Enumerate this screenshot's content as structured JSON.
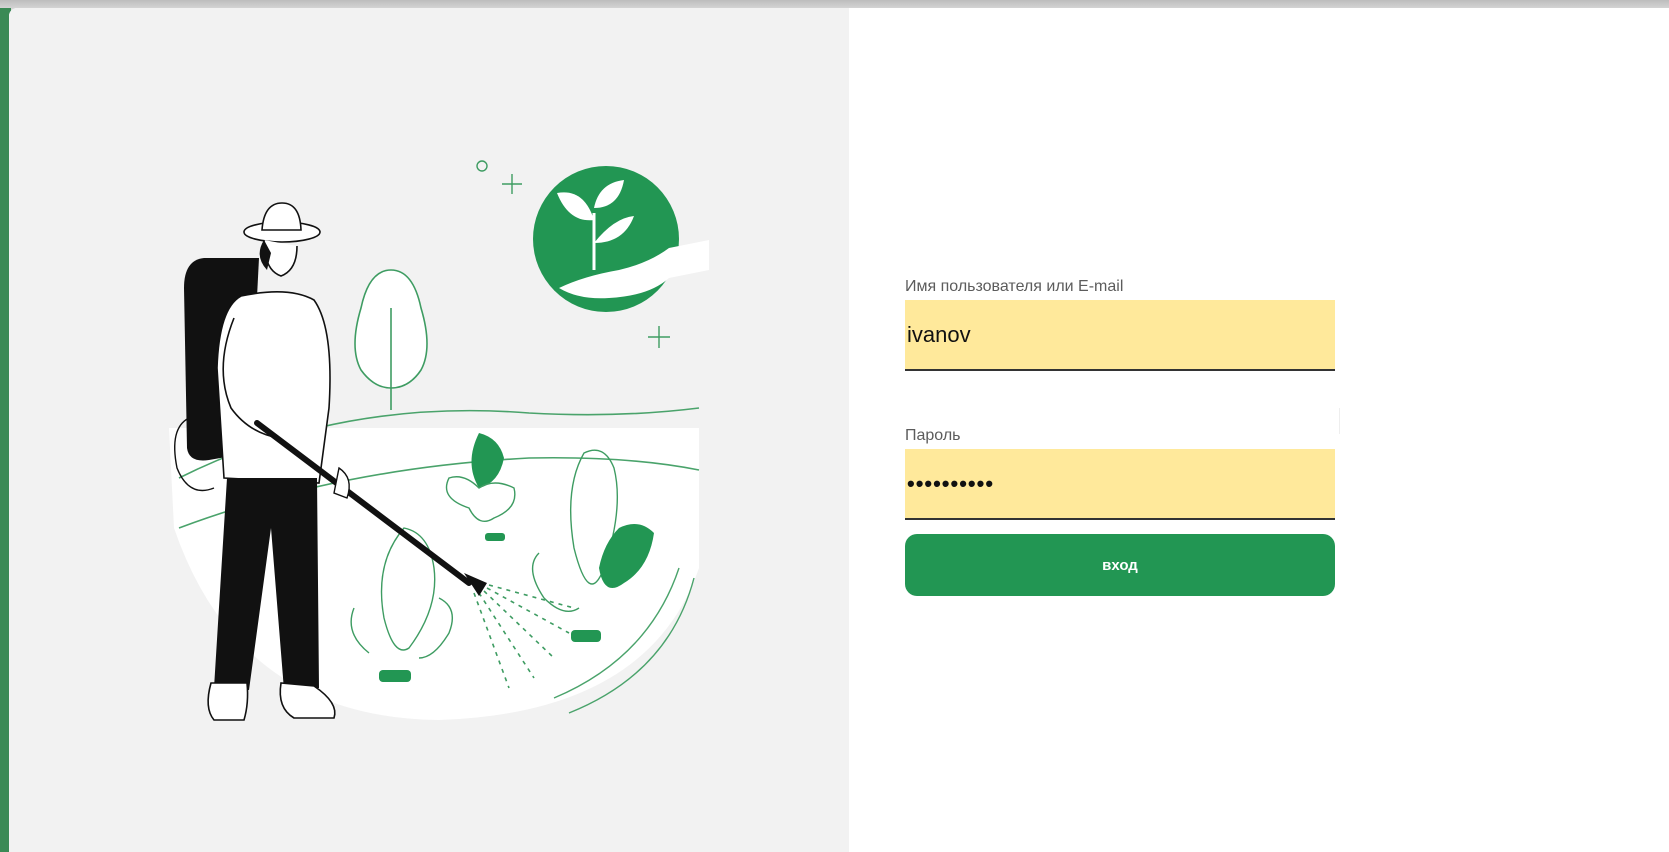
{
  "login": {
    "username_label": "Имя пользователя или E-mail",
    "username_value": "ivanov",
    "password_label": "Пароль",
    "password_value": "••••••••••",
    "submit_label": "вход"
  },
  "colors": {
    "accent": "#229653",
    "input_bg": "#ffe99b",
    "panel_bg": "#f2f2f2"
  },
  "illustration": {
    "subject": "gardener-watering-plants",
    "badge_icon": "sprout-in-hand-icon"
  }
}
